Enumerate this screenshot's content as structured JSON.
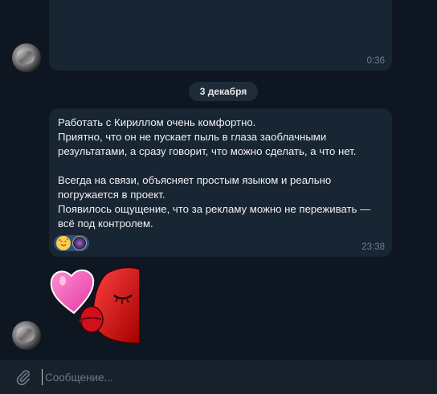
{
  "messages": [
    {
      "time": "0:36"
    },
    {
      "text": "Работать с Кириллом очень комфортно.\nПриятно, что он не пускает пыль в глаза заоблачными результатами, а сразу говорит, что можно сделать, а что нет.\n\nВсегда на связи, объясняет простым языком и реально погружается в проект.\nПоявилось ощущение, что за рекламу можно не переживать — всё под контролем.",
      "time": "23:38",
      "reactions": [
        {
          "icon": "smiling-face-with-hearts-emoji"
        },
        {
          "icon": "reactor-avatar"
        }
      ]
    }
  ],
  "date_separator": "3 декабря",
  "sticker": {
    "name": "pink-heart-kissing-lips-sticker"
  },
  "composer": {
    "placeholder": "Сообщение...",
    "attach_icon": "paperclip-icon"
  },
  "colors": {
    "background": "#0e1621",
    "bubble": "#182533",
    "composer": "#17212b",
    "reaction_pill": "#2b5278"
  }
}
